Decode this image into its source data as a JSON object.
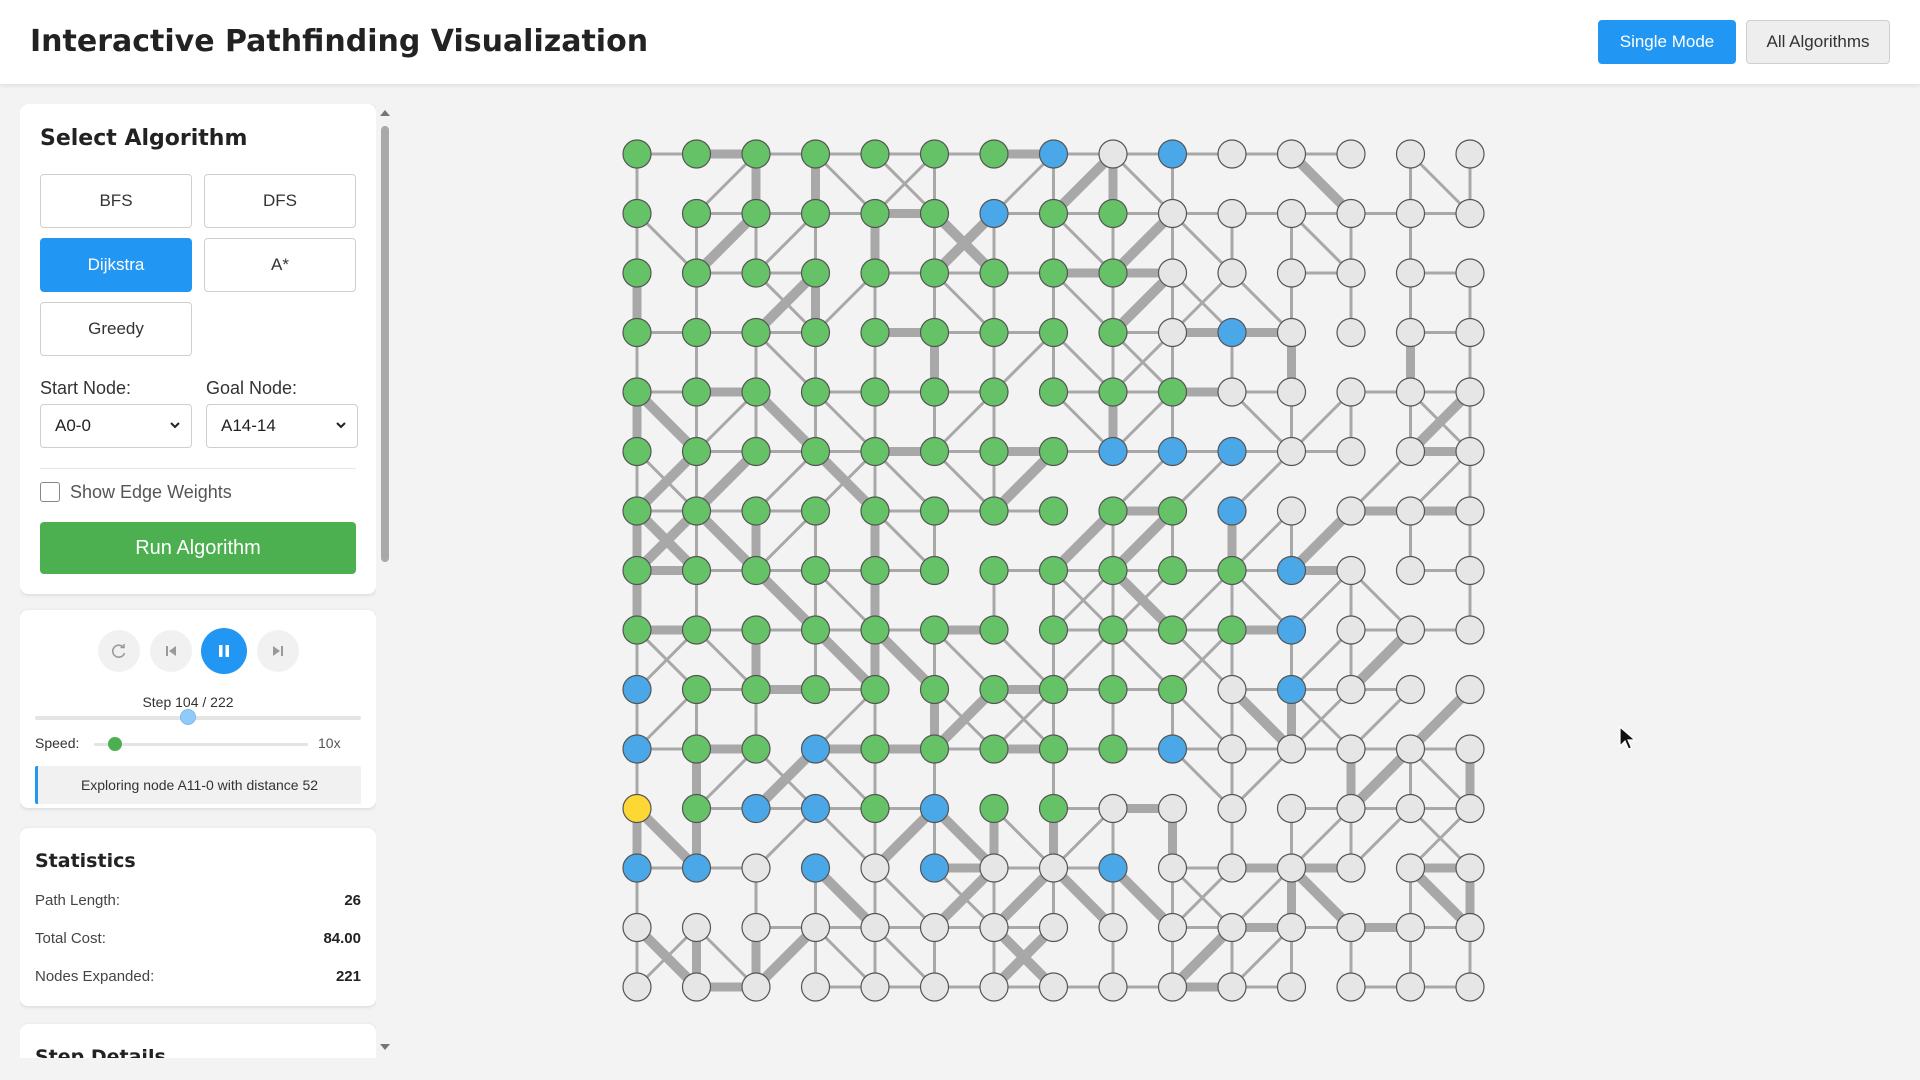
{
  "app": {
    "title": "Interactive Pathfinding Visualization"
  },
  "header": {
    "single_mode_label": "Single Mode",
    "all_algorithms_label": "All Algorithms"
  },
  "algorithm_panel": {
    "heading": "Select Algorithm",
    "algorithms": [
      "BFS",
      "DFS",
      "Dijkstra",
      "A*",
      "Greedy"
    ],
    "selected": "Dijkstra",
    "start_label": "Start Node:",
    "start_value": "A0-0",
    "goal_label": "Goal Node:",
    "goal_value": "A14-14",
    "show_weights_label": "Show Edge Weights",
    "show_weights_checked": false,
    "run_label": "Run Algorithm"
  },
  "playback": {
    "step_text": "Step 104 / 222",
    "step_current": 104,
    "step_total": 222,
    "speed_label": "Speed:",
    "speed_value": "10x",
    "speed_fraction": 0.1,
    "status": "Exploring node A11-0 with distance 52",
    "icons": [
      "reset-icon",
      "step-back-icon",
      "pause-icon",
      "step-forward-icon"
    ]
  },
  "statistics": {
    "heading": "Statistics",
    "rows": [
      {
        "label": "Path Length:",
        "value": "26"
      },
      {
        "label": "Total Cost:",
        "value": "84.00"
      },
      {
        "label": "Nodes Expanded:",
        "value": "221"
      }
    ]
  },
  "step_details": {
    "heading": "Step Details"
  },
  "colors": {
    "accent": "#2196f3",
    "run": "#4caf50",
    "visited": "#66c266",
    "frontier": "#4aa8e8",
    "unvisited": "#e6e6e6",
    "current": "#fdd835",
    "edge": "#a8a8a8"
  },
  "graph": {
    "rows": 15,
    "cols": 15,
    "node_states": [
      "GGGGGGGFUFUUUUU",
      "GGGGGGFGGUUUUUU",
      "GGGGGGGGGUUUUUU",
      "GGGGGGGGGUFUUUU",
      "GGGGGGGGGGUUUUU",
      "GGGGGGGGFFFUUUU",
      "GGGGGGGGGGFUUUU",
      "GGGGGGGGGGGFUUU",
      "GGGGGGGGGGGFUUU",
      "FGGGGGGGGGUFUUU",
      "FGGFGGGGGFUUUUU",
      "CGFFGFGGUUUUUUU",
      "FFUFUFUUFUUUUUU",
      "UUUUUUUUUUUUUUU",
      "UUUUUUUUUUUUUUU"
    ]
  }
}
